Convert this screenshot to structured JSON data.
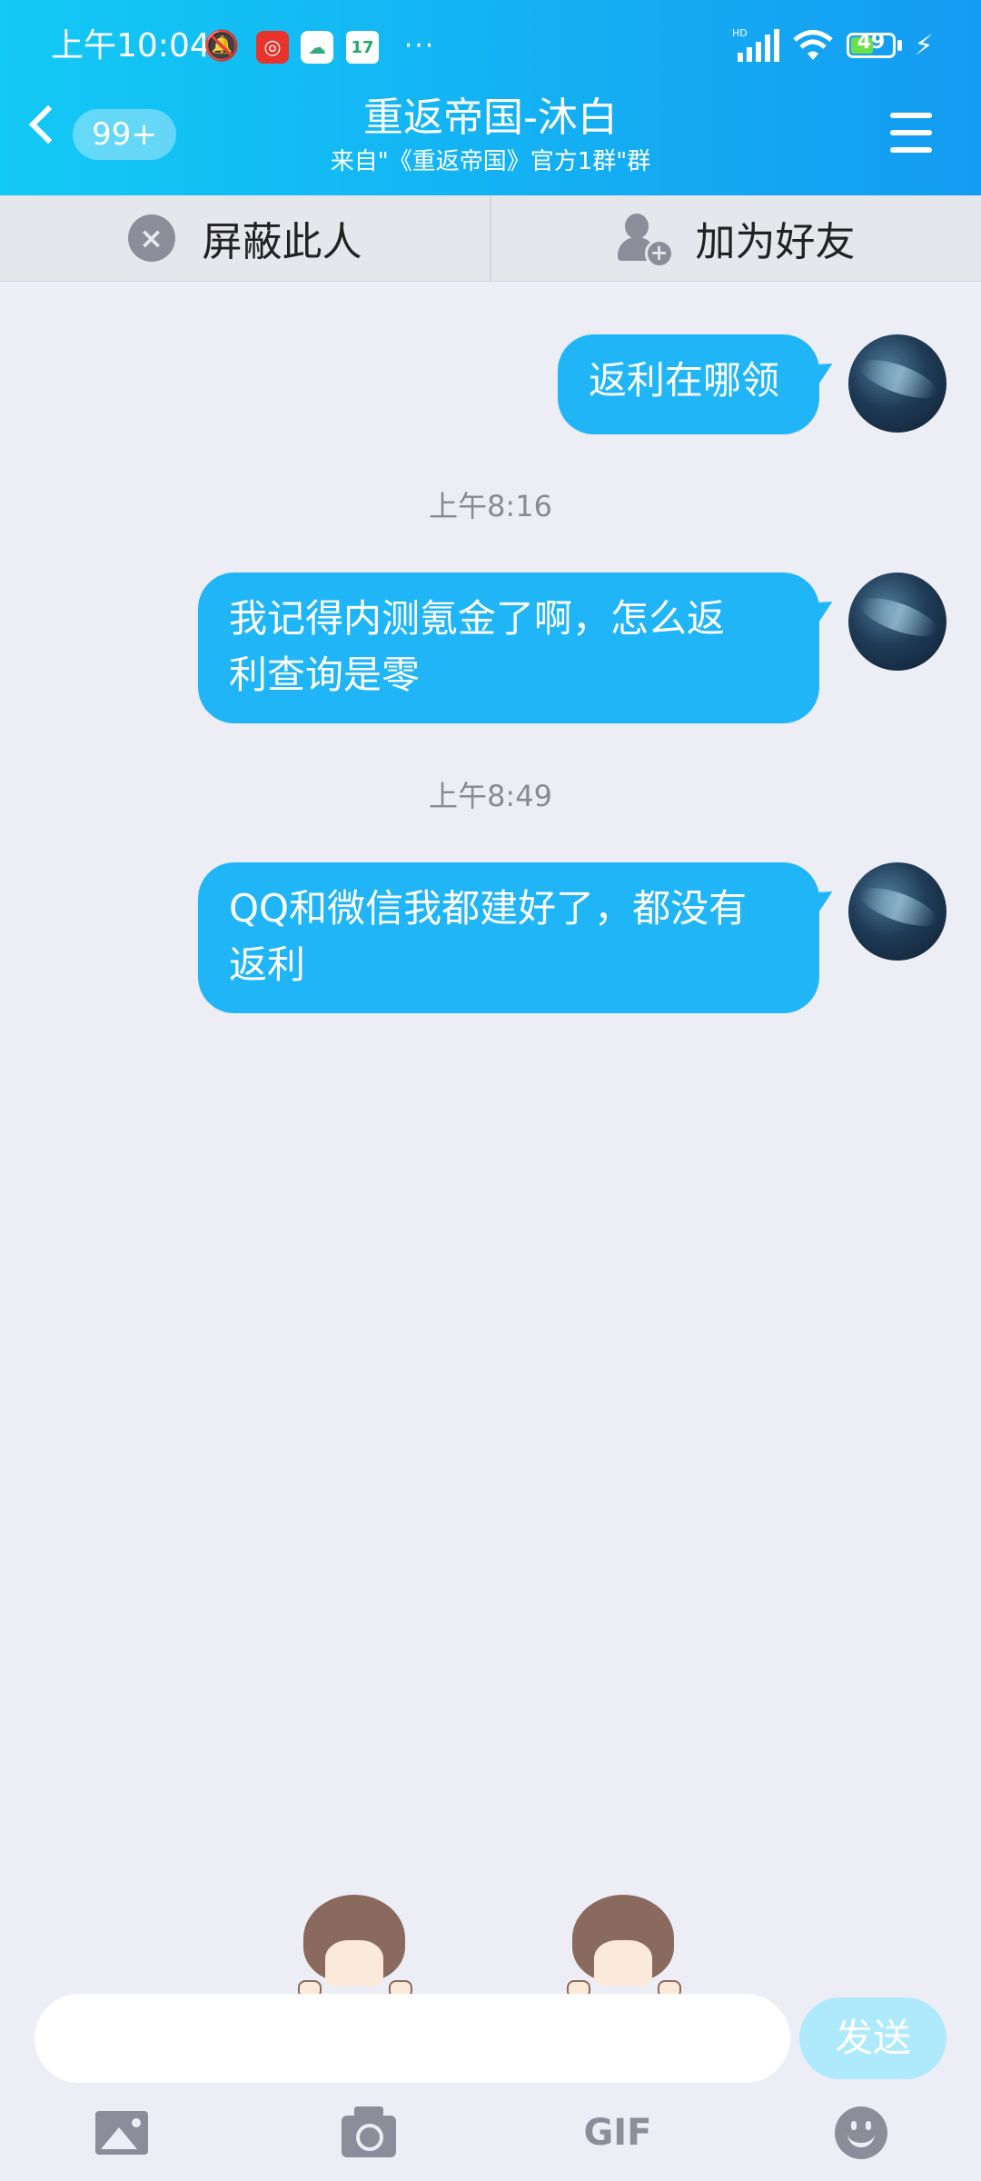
{
  "status_bar": {
    "time": "上午10:04",
    "signal_label": "HD",
    "battery": "49",
    "more": "···",
    "calendar_day": "17"
  },
  "header": {
    "unread_badge": "99+",
    "title": "重返帝国-沐白",
    "subtitle": "来自\"《重返帝国》官方1群\"群"
  },
  "actions": {
    "block": "屏蔽此人",
    "add_friend": "加为好友"
  },
  "messages": [
    {
      "text": "返利在哪领"
    },
    {
      "timestamp": "上午8:16",
      "text": "我记得内测氪金了啊，怎么返\n利查询是零"
    },
    {
      "timestamp": "上午8:49",
      "text": "QQ和微信我都建好了，都没有\n返利"
    }
  ],
  "composer": {
    "input_value": "",
    "send": "发送",
    "gif": "GIF"
  },
  "colors": {
    "header_start": "#13c9f5",
    "header_end": "#149cf2",
    "bubble": "#1fb5f6",
    "send_disabled": "#aeeafc"
  }
}
